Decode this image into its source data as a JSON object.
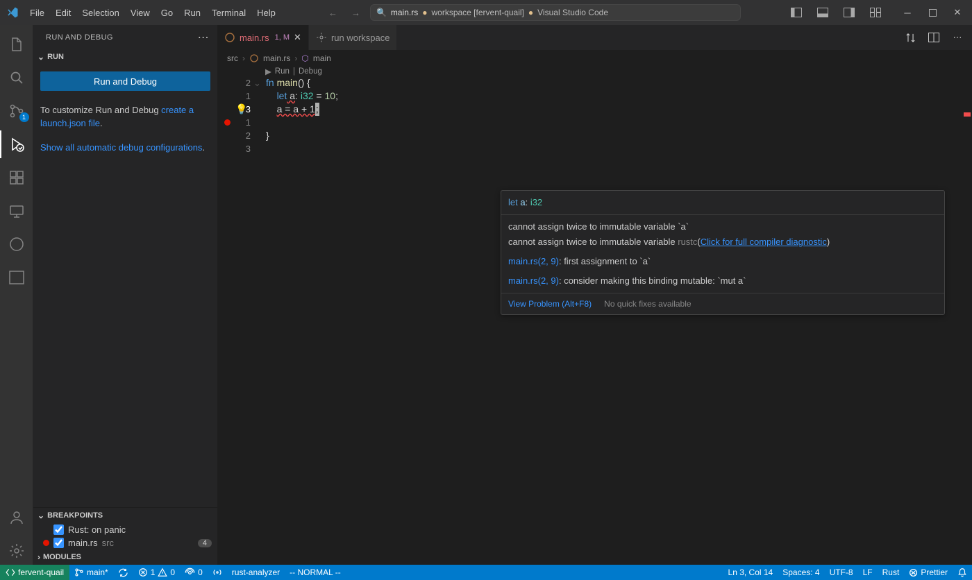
{
  "menu": [
    "File",
    "Edit",
    "Selection",
    "View",
    "Go",
    "Run",
    "Terminal",
    "Help"
  ],
  "search": {
    "icon": "🔍",
    "file": "main.rs",
    "workspace": "workspace [fervent-quail]",
    "app": "Visual Studio Code"
  },
  "sidebar": {
    "title": "RUN AND DEBUG",
    "run_section": "RUN",
    "run_btn": "Run and Debug",
    "help1_a": "To customize Run and Debug ",
    "help1_link": "create a launch.json file",
    "help1_b": ".",
    "help2_link": "Show all automatic debug configurations",
    "help2_b": ".",
    "breakpoints": "BREAKPOINTS",
    "bp1": "Rust: on panic",
    "bp2_file": "main.rs",
    "bp2_src": "src",
    "bp2_count": "4",
    "modules": "MODULES"
  },
  "tabs": {
    "t1_name": "main.rs",
    "t1_suffix": "1, M",
    "t2_name": "run workspace"
  },
  "breadcrumbs": {
    "a": "src",
    "b": "main.rs",
    "c": "main"
  },
  "codelens": {
    "run": "Run",
    "debug": "Debug"
  },
  "lines": {
    "l1_num": "2",
    "l1_fn": "fn ",
    "l1_main": "main",
    "l1_rest": "() {",
    "l2_num": "1",
    "l2_let": "let",
    "l2_a": " a",
    "l2_colon": ": ",
    "l2_ty": "i32",
    "l2_eq": " = ",
    "l2_val": "10",
    "l2_sc": ";",
    "l3_num": "3",
    "l3_code": "a = a + 1",
    "l3_sc": ";",
    "l4_num": "1",
    "l4_txt": "",
    "l5_num": "2",
    "l5_txt": "}",
    "l6_num": "3"
  },
  "hover": {
    "decl_let": "let",
    "decl_a": " a",
    "decl_colon": ": ",
    "decl_ty": "i32",
    "err1": "cannot assign twice to immutable variable `a`",
    "err2_a": "cannot assign twice to immutable variable ",
    "err2_src": "rustc",
    "err2_link": "Click for full compiler diagnostic",
    "loc1": "main.rs(2, 9)",
    "loc1_t": ": first assignment to `a`",
    "loc2": "main.rs(2, 9)",
    "loc2_t": ": consider making this binding mutable: `mut a`",
    "view": "View Problem (Alt+F8)",
    "nofix": "No quick fixes available"
  },
  "status": {
    "remote": "fervent-quail",
    "branch": "main*",
    "errs": "1",
    "warns": "0",
    "ports": "0",
    "radio": "",
    "analyzer": "rust-analyzer",
    "vim": "-- NORMAL --",
    "ln": "Ln 3, Col 14",
    "spaces": "Spaces: 4",
    "enc": "UTF-8",
    "eol": "LF",
    "lang": "Rust",
    "prettier": "Prettier"
  }
}
